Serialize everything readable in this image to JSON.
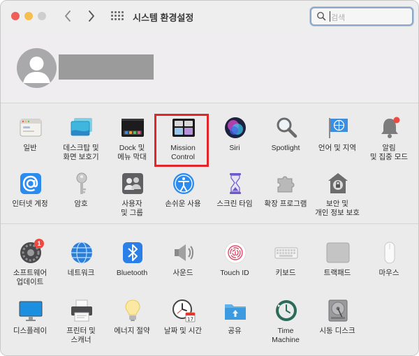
{
  "window": {
    "title": "시스템 환경설정",
    "search_placeholder": "검색"
  },
  "account": {
    "name": ""
  },
  "panes_top": [
    {
      "label": "일반",
      "icon": "general-icon"
    },
    {
      "label": "데스크탑 및\n화면 보호기",
      "icon": "desktop-screensaver-icon"
    },
    {
      "label": "Dock 및\n메뉴 막대",
      "icon": "dock-icon"
    },
    {
      "label": "Mission\nControl",
      "icon": "mission-control-icon"
    },
    {
      "label": "Siri",
      "icon": "siri-icon"
    },
    {
      "label": "Spotlight",
      "icon": "spotlight-icon"
    },
    {
      "label": "언어 및 지역",
      "icon": "flag-icon"
    },
    {
      "label": "알림\n및 집중 모드",
      "icon": "bell-icon"
    },
    {
      "label": "인터넷 계정",
      "icon": "at-icon"
    },
    {
      "label": "암호",
      "icon": "key-icon"
    },
    {
      "label": "사용자\n및 그룹",
      "icon": "users-icon"
    },
    {
      "label": "손쉬운 사용",
      "icon": "accessibility-icon"
    },
    {
      "label": "스크린 타임",
      "icon": "hourglass-icon"
    },
    {
      "label": "확장 프로그램",
      "icon": "puzzle-icon"
    },
    {
      "label": "보안 및\n개인 정보 보호",
      "icon": "house-lock-icon"
    }
  ],
  "panes_bottom": [
    {
      "label": "소프트웨어\n업데이트",
      "icon": "software-update-icon",
      "badge": "1"
    },
    {
      "label": "네트워크",
      "icon": "globe-icon"
    },
    {
      "label": "Bluetooth",
      "icon": "bluetooth-icon"
    },
    {
      "label": "사운드",
      "icon": "speaker-icon"
    },
    {
      "label": "Touch ID",
      "icon": "fingerprint-icon"
    },
    {
      "label": "키보드",
      "icon": "keyboard-icon"
    },
    {
      "label": "트랙패드",
      "icon": "trackpad-icon"
    },
    {
      "label": "마우스",
      "icon": "mouse-icon"
    },
    {
      "label": "디스플레이",
      "icon": "display-icon"
    },
    {
      "label": "프린터 및\n스캐너",
      "icon": "printer-icon"
    },
    {
      "label": "에너지 절약",
      "icon": "lightbulb-icon"
    },
    {
      "label": "날짜 및 시간",
      "icon": "clock-calendar-icon"
    },
    {
      "label": "공유",
      "icon": "folder-share-icon"
    },
    {
      "label": "Time\nMachine",
      "icon": "time-machine-icon"
    },
    {
      "label": "시동 디스크",
      "icon": "disk-icon"
    }
  ],
  "colors": {
    "highlight": "#e2252b",
    "badge": "#ef4a42"
  }
}
